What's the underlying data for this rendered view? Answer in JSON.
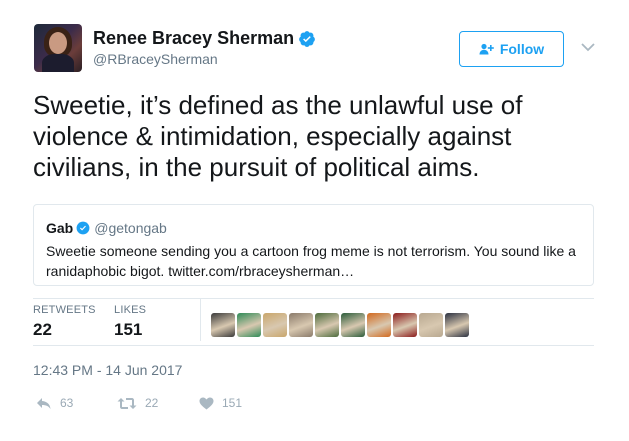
{
  "author": {
    "display_name": "Renee Bracey Sherman",
    "handle": "@RBraceySherman",
    "verified_icon": "verified-badge-icon"
  },
  "follow_button": {
    "label": "Follow",
    "icon": "add-user-icon"
  },
  "menu_icon": "chevron-down-icon",
  "tweet_text": "Sweetie, it’s defined as the unlawful use of violence & intimidation, especially against civilians, in the pursuit of political aims.",
  "quoted_tweet": {
    "name": "Gab",
    "handle": "@getongab",
    "text": "Sweetie someone sending you a cartoon frog meme is not terrorism. You sound like a ranidaphobic bigot. twitter.com/rbraceysherman…"
  },
  "stats": {
    "retweets_label": "RETWEETS",
    "retweets_value": "22",
    "likes_label": "LIKES",
    "likes_value": "151"
  },
  "likers": [
    {
      "name": "liker-1",
      "color": "#3a3a3a"
    },
    {
      "name": "liker-2",
      "color": "#2e8b57"
    },
    {
      "name": "liker-3",
      "color": "#c9a66b"
    },
    {
      "name": "liker-4",
      "color": "#8a7a6a"
    },
    {
      "name": "liker-5",
      "color": "#4c6b3c"
    },
    {
      "name": "liker-6",
      "color": "#2b5c3a"
    },
    {
      "name": "liker-7",
      "color": "#d2691e"
    },
    {
      "name": "liker-8",
      "color": "#8b1a1a"
    },
    {
      "name": "liker-9",
      "color": "#b8a890"
    },
    {
      "name": "liker-10",
      "color": "#2a3040"
    }
  ],
  "timestamp": "12:43 PM - 14 Jun 2017",
  "actions": {
    "reply_count": "63",
    "retweet_count": "22",
    "like_count": "151"
  },
  "colors": {
    "accent": "#1da1f2",
    "text": "#14171a",
    "muted": "#657786",
    "border": "#e1e8ed"
  }
}
